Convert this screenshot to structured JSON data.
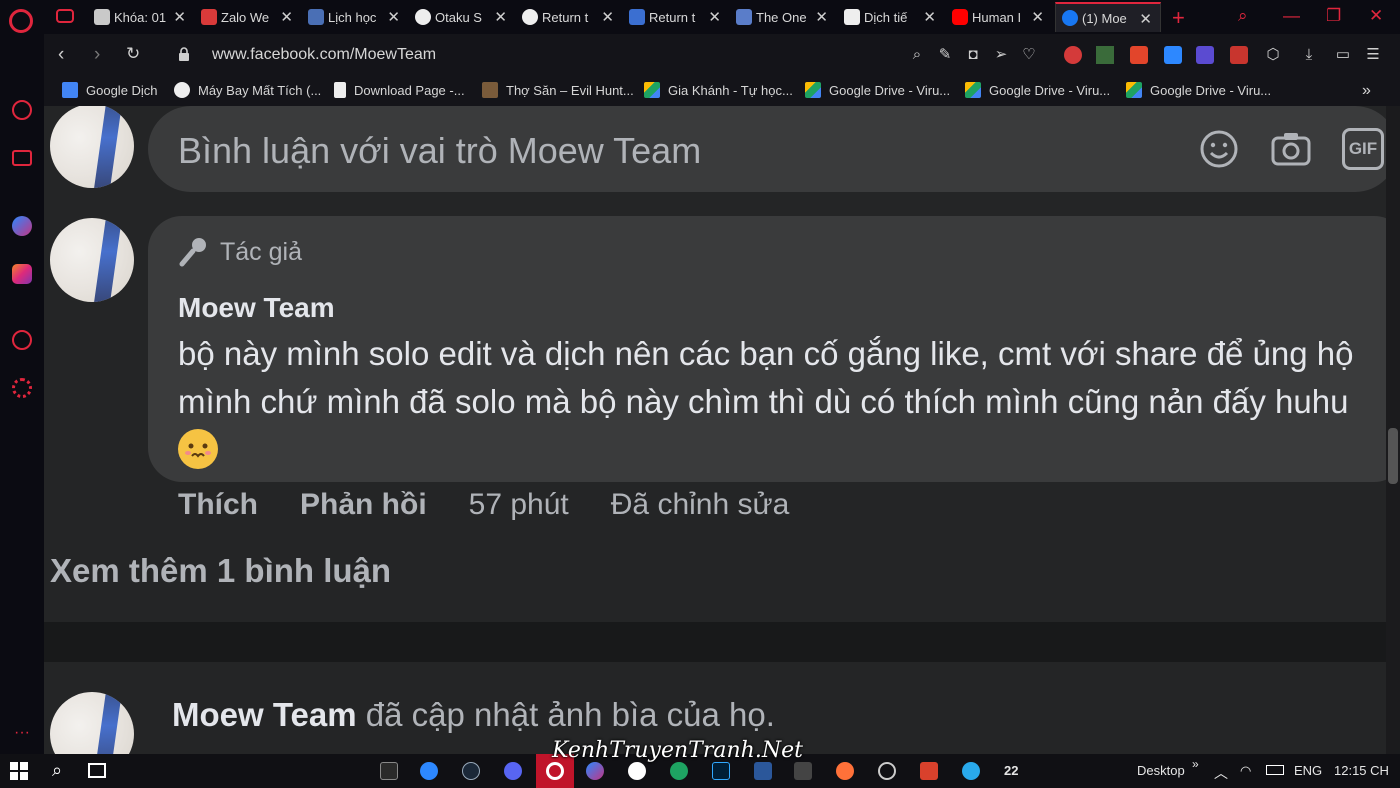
{
  "browser": {
    "tabs": [
      {
        "title": "Khóa: 01",
        "color": "#c9c9c9"
      },
      {
        "title": "Zalo We",
        "color": "#d93a3a"
      },
      {
        "title": "Lịch học",
        "color": "#4a6fb5"
      },
      {
        "title": "Otaku S",
        "color": "#eeeeee"
      },
      {
        "title": "Return t",
        "color": "#eeeeee"
      },
      {
        "title": "Return t",
        "color": "#3b6fd1"
      },
      {
        "title": "The One",
        "color": "#5a7dc9"
      },
      {
        "title": "Dịch tiế",
        "color": "#eeeeee"
      },
      {
        "title": "Human I",
        "color": "#ff0000"
      },
      {
        "title": "(1) Moe",
        "color": "#1877f2"
      }
    ],
    "url": "www.facebook.com/MoewTeam",
    "bookmarks": [
      {
        "label": "Google Dịch",
        "color": "#4285f4"
      },
      {
        "label": "Máy Bay Mất Tích (...",
        "color": "#eeeeee"
      },
      {
        "label": "Download Page -...",
        "color": "#eeeeee"
      },
      {
        "label": "Thợ Săn – Evil Hunt...",
        "color": "#7a5b3a"
      },
      {
        "label": "Gia Khánh - Tự học...",
        "color": "#1ea362"
      },
      {
        "label": "Google Drive - Viru...",
        "color": "#1ea362"
      },
      {
        "label": "Google Drive - Viru...",
        "color": "#1ea362"
      },
      {
        "label": "Google Drive - Viru...",
        "color": "#1ea362"
      }
    ],
    "bookmarks_more": "»",
    "accent": "#e0263d"
  },
  "facebook": {
    "comment_input_placeholder": "Bình luận với vai trò Moew Team",
    "gif_label": "GIF",
    "comment": {
      "badge": "Tác giả",
      "author": "Moew Team",
      "text": "bộ này mình solo edit và dịch nên các bạn cố gắng like, cmt với share để ủng hộ mình chứ mình đã solo mà bộ này chìm thì dù có thích mình cũng nản đấy huhu",
      "like_label": "Thích",
      "reply_label": "Phản hồi",
      "time": "57 phút",
      "edited": "Đã chỉnh sửa"
    },
    "more_comments": "Xem thêm 1 bình luận",
    "next_post": {
      "author": "Moew Team",
      "action": "đã cập nhật ảnh bìa của họ."
    }
  },
  "taskbar": {
    "desktop_label": "Desktop",
    "lang": "ENG",
    "time": "12:15 CH",
    "badge": "22",
    "chevron": "»"
  },
  "watermark": "KenhTruyenTranh.Net"
}
